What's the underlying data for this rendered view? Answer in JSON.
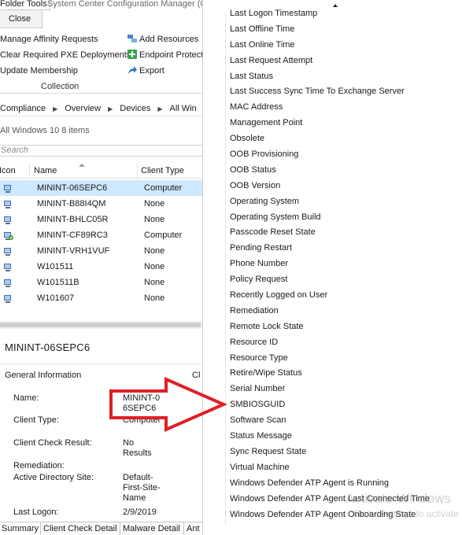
{
  "ribbon": {
    "folder_tools_tab": "Folder Tools",
    "window_title": "System Center Configuration Manager (Co",
    "close_tab": "Close",
    "manage_affinity": "Manage Affinity Requests",
    "clear_pxe": "Clear Required PXE Deployments",
    "update_membership": "Update Membership",
    "add_resources": "Add Resources",
    "endpoint_protection": "Endpoint Protect",
    "export": "Export",
    "group_label": "Collection"
  },
  "breadcrumb": [
    "Compliance",
    "Overview",
    "Devices",
    "All Win"
  ],
  "list": {
    "title": "All Windows 10 8 items",
    "search_placeholder": "Search",
    "columns": [
      "Icon",
      "Name",
      "Client Type"
    ],
    "rows": [
      {
        "name": "MININT-06SEPC6",
        "client_type": "Computer",
        "icon": "computer-icon"
      },
      {
        "name": "MININT-B88I4QM",
        "client_type": "None",
        "icon": "computer-icon"
      },
      {
        "name": "MININT-BHLC05R",
        "client_type": "None",
        "icon": "computer-icon"
      },
      {
        "name": "MININT-CF89RC3",
        "client_type": "Computer",
        "icon": "computer-check-icon"
      },
      {
        "name": "MININT-VRH1VUF",
        "client_type": "None",
        "icon": "computer-icon"
      },
      {
        "name": "W101511",
        "client_type": "None",
        "icon": "computer-icon"
      },
      {
        "name": "W101511B",
        "client_type": "None",
        "icon": "computer-icon"
      },
      {
        "name": "W101607",
        "client_type": "None",
        "icon": "computer-icon"
      }
    ]
  },
  "details": {
    "title": "MININT-06SEPC6",
    "section": "General Information",
    "cut_header": "Cl",
    "fields": {
      "name_label": "Name:",
      "name_value": "MININT-06SEPC6",
      "client_type_label": "Client Type:",
      "client_type_value": "Computer",
      "check_result_label": "Client Check Result:",
      "check_result_value": "No Results",
      "remediation_label": "Remediation:",
      "ad_site_label": "Active Directory Site:",
      "ad_site_value": "Default-First-Site-Name",
      "last_logon_label": "Last Logon:",
      "last_logon_value": "2/9/2019"
    }
  },
  "bottom_tabs": [
    "Summary",
    "Client Check Detail",
    "Malware Detail",
    "Ant"
  ],
  "menu": {
    "items": [
      "Last Logon Timestamp",
      "Last Offline Time",
      "Last Online Time",
      "Last Request Attempt",
      "Last Status",
      "Last Success Sync Time To Exchange Server",
      "MAC Address",
      "Management Point",
      "Obsolete",
      "OOB Provisioning",
      "OOB Status",
      "OOB Version",
      "Operating System",
      "Operating System Build",
      "Passcode Reset State",
      "Pending Restart",
      "Phone Number",
      "Policy Request",
      "Recently Logged on User",
      "Remediation",
      "Remote Lock State",
      "Resource ID",
      "Resource Type",
      "Retire/Wipe Status",
      "Serial Number",
      "SMBIOSGUID",
      "Software Scan",
      "Status Message",
      "Sync Request State",
      "Virtual Machine",
      "Windows Defender ATP Agent is Running",
      "Windows Defender ATP Agent Last Connected Time",
      "Windows Defender ATP Agent Onboarding State"
    ]
  },
  "watermark": {
    "line1": "Activate Windows",
    "line2": "Go to Settings to activate"
  },
  "colors": {
    "selection": "#cde8ff",
    "annotation_arrow": "#e01f26"
  }
}
